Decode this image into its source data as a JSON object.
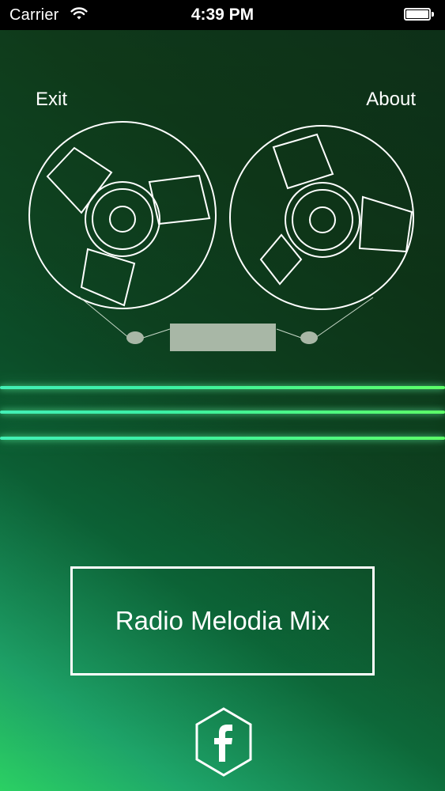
{
  "status_bar": {
    "carrier": "Carrier",
    "time": "4:39 PM"
  },
  "nav": {
    "exit_label": "Exit",
    "about_label": "About"
  },
  "station": {
    "label": "Radio Melodia Mix"
  },
  "icons": {
    "wifi": "wifi-icon",
    "battery": "battery-icon",
    "reel_left": "tape-reel-icon",
    "reel_right": "tape-reel-icon",
    "tape_head": "tape-head-icon",
    "facebook": "facebook-icon"
  },
  "colors": {
    "accent_glow": "#43f0b6",
    "background_top": "#0d2f18",
    "background_bottom": "#2bd063",
    "foreground": "#ffffff"
  }
}
